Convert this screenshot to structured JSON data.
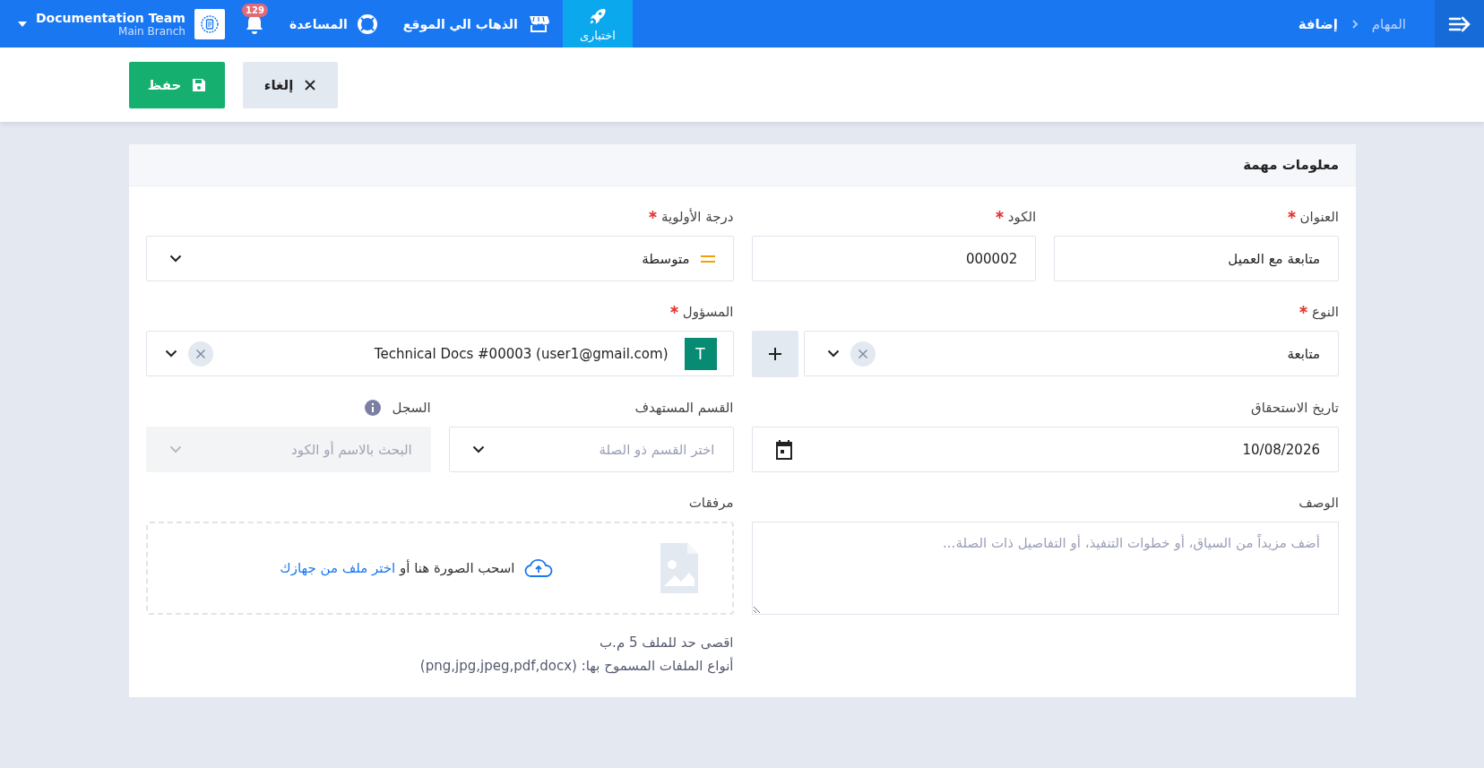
{
  "topbar": {
    "breadcrumb": [
      {
        "label": "المهام",
        "current": false
      },
      {
        "label": "إضافة",
        "current": true
      }
    ],
    "nav": [
      {
        "kind": "test",
        "label": "اختبارى",
        "selected": true
      },
      {
        "kind": "site",
        "label": "الذهاب الي الموقع",
        "selected": false
      },
      {
        "kind": "help",
        "label": "المساعدة",
        "selected": false
      }
    ],
    "notifications": {
      "count": "129"
    },
    "account": {
      "name": "Documentation Team",
      "branch": "Main Branch"
    }
  },
  "actions": [
    {
      "kind": "cancel",
      "label": "إلغاء"
    },
    {
      "kind": "save",
      "label": "حفظ"
    }
  ],
  "card": {
    "title": "معلومات مهمة"
  },
  "form": {
    "title": {
      "label": "العنوان",
      "required": true,
      "value": "متابعة مع العميل"
    },
    "code": {
      "label": "الكود",
      "required": true,
      "value": "000002"
    },
    "priority": {
      "label": "درجة الأولوية",
      "required": true,
      "value": "متوسطة"
    },
    "type": {
      "label": "النوع",
      "required": true,
      "value": "متابعة"
    },
    "responsible": {
      "label": "المسؤول",
      "required": true,
      "avatar": "T",
      "value": "Technical Docs #00003 (user1@gmail.com)"
    },
    "due_date": {
      "label": "تاريخ الاستحقاق",
      "value": "10/08/2026"
    },
    "department": {
      "label": "القسم المستهدف",
      "placeholder": "اختر القسم ذو الصلة"
    },
    "record": {
      "label": "السجل",
      "disabled": true,
      "placeholder": "البحث بالاسم أو الكود"
    },
    "description": {
      "label": "الوصف",
      "placeholder": "أضف مزيداً من السياق، أو خطوات التنفيذ، أو التفاصيل ذات الصلة..."
    },
    "attachments": {
      "label": "مرفقات",
      "drop_text": "اسحب الصورة هنا أو",
      "link": "اختر ملف من جهازك",
      "notes": [
        "اقصى حد للملف 5 م.ب",
        "أنواع الملفات المسموح بها: (png,jpg,jpeg,pdf,docx)"
      ]
    }
  }
}
